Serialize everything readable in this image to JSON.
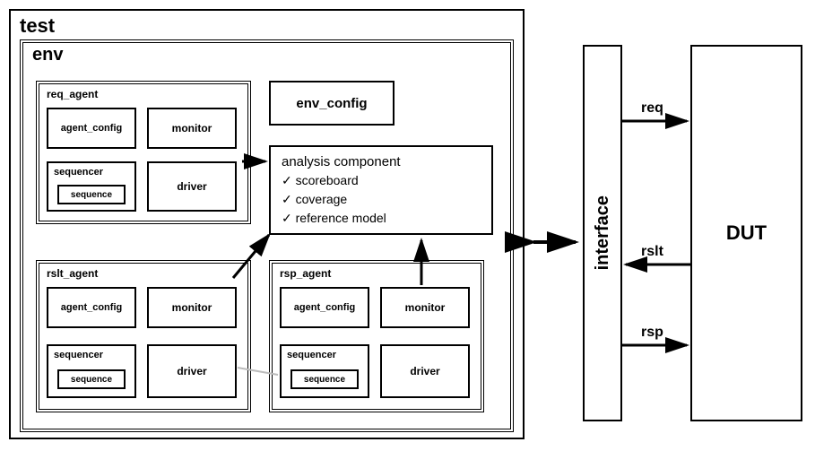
{
  "test": {
    "title": "test"
  },
  "env": {
    "title": "env"
  },
  "env_config": {
    "label": "env_config"
  },
  "analysis": {
    "title": "analysis component",
    "items": {
      "i0": "scoreboard",
      "i1": "coverage",
      "i2": "reference model"
    }
  },
  "req_agent": {
    "title": "req_agent",
    "agent_config": "agent_config",
    "monitor": "monitor",
    "sequencer": "sequencer",
    "sequence": "sequence",
    "driver": "driver"
  },
  "rslt_agent": {
    "title": "rslt_agent",
    "agent_config": "agent_config",
    "monitor": "monitor",
    "sequencer": "sequencer",
    "sequence": "sequence",
    "driver": "driver"
  },
  "rsp_agent": {
    "title": "rsp_agent",
    "agent_config": "agent_config",
    "monitor": "monitor",
    "sequencer": "sequencer",
    "sequence": "sequence",
    "driver": "driver"
  },
  "interface": {
    "label": "interface"
  },
  "dut": {
    "label": "DUT"
  },
  "signals": {
    "req": "req",
    "rslt": "rslt",
    "rsp": "rsp"
  }
}
